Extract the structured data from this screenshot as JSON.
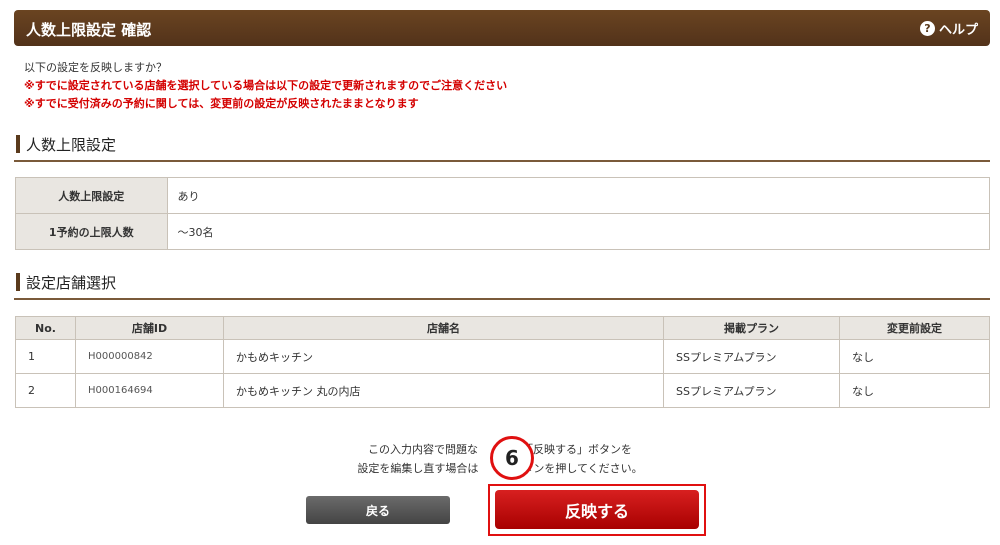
{
  "header": {
    "title": "人数上限設定 確認",
    "help_label": "ヘルプ",
    "help_icon": "question-circle-icon"
  },
  "intro": {
    "question": "以下の設定を反映しますか？",
    "warning1": "※すでに設定されている店舗を選択している場合は以下の設定で更新されますのでご注意ください",
    "warning2": "※すでに受付済みの予約に関しては、変更前の設定が反映されたままとなります"
  },
  "section_limit": {
    "title": "人数上限設定"
  },
  "limit_table": [
    {
      "label": "人数上限設定",
      "value": "あり"
    },
    {
      "label": "1予約の上限人数",
      "value": "～30名"
    }
  ],
  "section_stores": {
    "title": "設定店舗選択"
  },
  "stores_table": {
    "headers": [
      "No.",
      "店舗ID",
      "店舗名",
      "掲載プラン",
      "変更前設定"
    ],
    "rows": [
      {
        "no": "1",
        "id": "H000000842",
        "name": "かもめキッチン",
        "plan": "SSプレミアムプラン",
        "prev": "なし"
      },
      {
        "no": "2",
        "id": "H000164694",
        "name": "かもめキッチン 丸の内店",
        "plan": "SSプレミアムプラン",
        "prev": "なし"
      }
    ]
  },
  "message": {
    "line1a": "この入力内容で問題な",
    "line1b": "「反映する」ボタンを",
    "line2a": "設定を編集し直す場合は",
    "line2b": "タンを押してください。"
  },
  "buttons": {
    "back": "戻る",
    "apply": "反映する"
  },
  "annotation": {
    "step_number": "6"
  },
  "colors": {
    "header_bg": "#5a3a1c",
    "warning": "#d40000",
    "apply_button": "#c01010",
    "highlight": "#e01010"
  }
}
